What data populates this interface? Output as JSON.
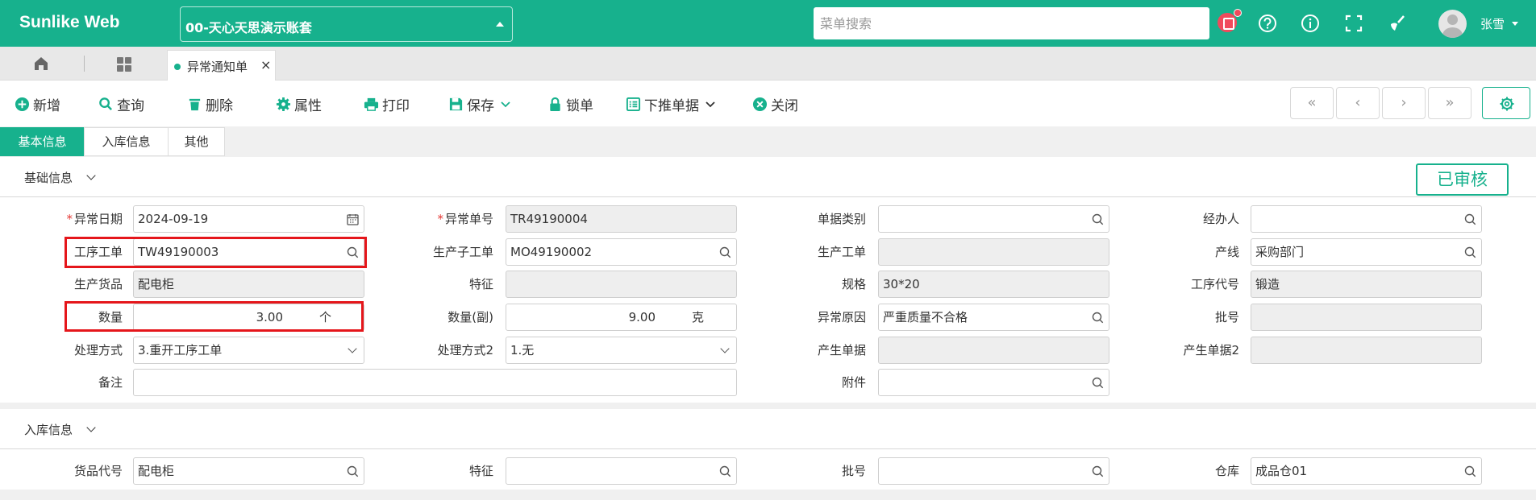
{
  "app": {
    "logo": "Sunlike Web",
    "account": "00-天心天思演示账套",
    "search_placeholder": "菜单搜索",
    "username": "张雪"
  },
  "tabs": {
    "doc_tab_label": "异常通知单",
    "close": "×"
  },
  "toolbar": {
    "new": "新增",
    "query": "查询",
    "delete": "删除",
    "properties": "属性",
    "print": "打印",
    "save": "保存",
    "lock": "锁单",
    "push_down": "下推单据",
    "close": "关闭",
    "first": "«",
    "prev": "‹",
    "next": "›",
    "last": "»"
  },
  "form_tabs": [
    "基本信息",
    "入库信息",
    "其他"
  ],
  "status": {
    "approved": "已审核"
  },
  "section_basic": {
    "title": "基础信息",
    "labels": {
      "abnormal_date": "异常日期",
      "abnormal_no": "异常单号",
      "doc_type": "单据类别",
      "handler": "经办人",
      "process_order": "工序工单",
      "sub_order": "生产子工单",
      "prod_order": "生产工单",
      "line": "产线",
      "prod_goods": "生产货品",
      "feature": "特征",
      "spec": "规格",
      "process_code": "工序代号",
      "qty": "数量",
      "qty_sub": "数量(副)",
      "reason": "异常原因",
      "batch": "批号",
      "method": "处理方式",
      "method2": "处理方式2",
      "gen_doc": "产生单据",
      "gen_doc2": "产生单据2",
      "remark": "备注",
      "attachment": "附件"
    },
    "values": {
      "abnormal_date": "2024-09-19",
      "abnormal_no": "TR49190004",
      "doc_type": "",
      "handler": "",
      "process_order": "TW49190003",
      "sub_order": "MO49190002",
      "prod_order": "",
      "line": "采购部门",
      "prod_goods": "配电柜",
      "feature": "",
      "spec": "30*20",
      "process_code": "锻造",
      "qty": "3.00",
      "qty_unit": "个",
      "qty_sub": "9.00",
      "qty_sub_unit": "克",
      "reason": "严重质量不合格",
      "batch": "",
      "method": "3.重开工序工单",
      "method2": "1.无",
      "gen_doc": "",
      "gen_doc2": "",
      "remark": "",
      "attachment": ""
    }
  },
  "section_stock": {
    "title": "入库信息",
    "labels": {
      "goods_code": "货品代号",
      "feature": "特征",
      "batch": "批号",
      "warehouse": "仓库"
    },
    "values": {
      "goods_code": "配电柜",
      "feature": "",
      "batch": "",
      "warehouse": "成品仓01"
    }
  },
  "colors": {
    "brand": "#17b18d",
    "required": "#e53935",
    "highlight": "#e5161b"
  }
}
